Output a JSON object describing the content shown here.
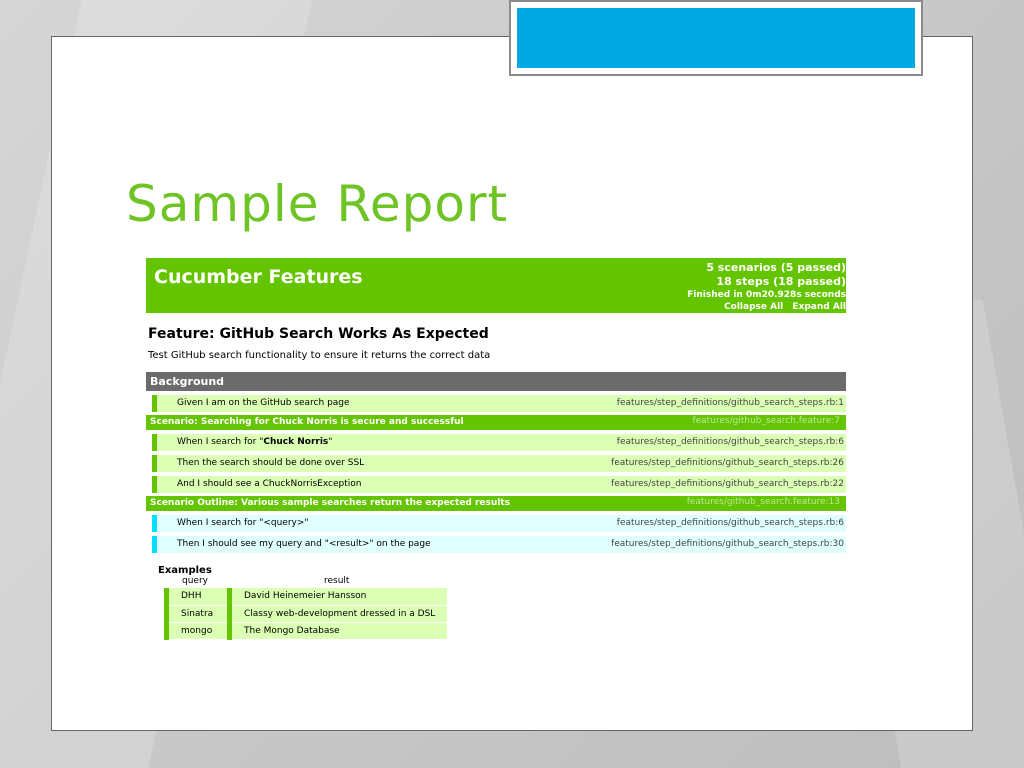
{
  "slide": {
    "title": "Sample Report",
    "accent_color": "#00a9e4",
    "title_color": "#6ec425"
  },
  "report": {
    "header_title": "Cucumber Features",
    "stats": {
      "scenarios": "5 scenarios (5 passed)",
      "steps": "18 steps (18 passed)",
      "finished": "Finished in 0m20.928s seconds",
      "collapse_all": "Collapse All",
      "expand_all": "Expand All"
    },
    "feature_title": "Feature: GitHub Search Works As Expected",
    "feature_description": "Test GitHub search functionality to ensure it returns the correct data",
    "background": {
      "label": "Background",
      "steps": [
        {
          "text": "Given I am on the GitHub search page",
          "location": "features/step_definitions/github_search_steps.rb:1"
        }
      ]
    },
    "scenario": {
      "label": "Scenario: Searching for Chuck Norris is secure and successful",
      "file_ref": "features/github_search.feature:7",
      "steps": [
        {
          "prefix": "When I search for \"",
          "strong": "Chuck Norris",
          "suffix": "\"",
          "location": "features/step_definitions/github_search_steps.rb:6"
        },
        {
          "prefix": "Then the search should be done over SSL",
          "strong": "",
          "suffix": "",
          "location": "features/step_definitions/github_search_steps.rb:26"
        },
        {
          "prefix": "And I should see a ChuckNorrisException",
          "strong": "",
          "suffix": "",
          "location": "features/step_definitions/github_search_steps.rb:22"
        }
      ]
    },
    "outline": {
      "label": "Scenario Outline: Various sample searches return the expected results",
      "file_ref": "features/github_search.feature:13",
      "steps": [
        {
          "text": "When I search for \"<query>\"",
          "location": "features/step_definitions/github_search_steps.rb:6"
        },
        {
          "text": "Then I should see my query and \"<result>\" on the page",
          "location": "features/step_definitions/github_search_steps.rb:30"
        }
      ]
    },
    "examples": {
      "label": "Examples",
      "columns": [
        "query",
        "result"
      ],
      "rows": [
        [
          "DHH",
          "David Heinemeier Hansson"
        ],
        [
          "Sinatra",
          "Classy web-development dressed in a DSL"
        ],
        [
          "mongo",
          "The Mongo Database"
        ]
      ]
    }
  },
  "colors": {
    "passed_green": "#65c400",
    "passed_bg": "#dbffb4",
    "outline_cyan": "#00e0ff",
    "outline_bg": "#e0ffff",
    "background_bar": "#6b6b6b"
  }
}
